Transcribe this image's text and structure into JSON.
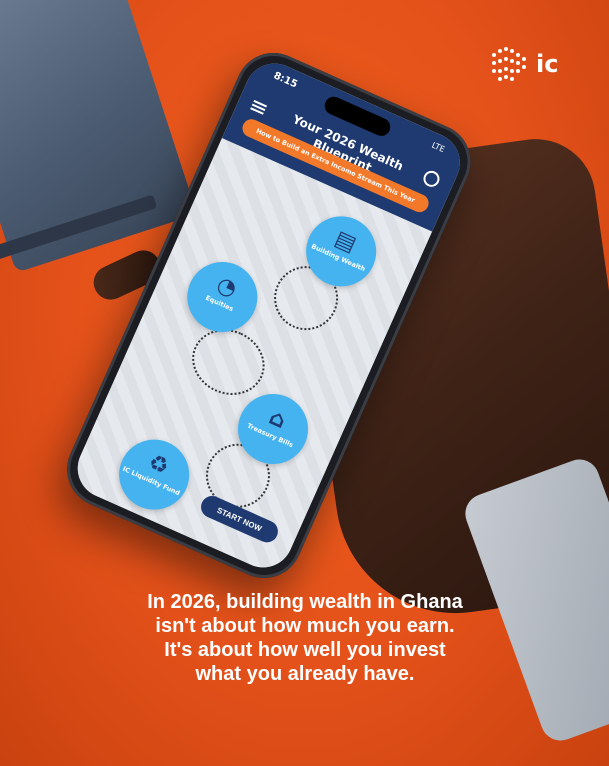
{
  "brand": {
    "logo_text": "ic",
    "accent": "#e8561c"
  },
  "phone": {
    "status_time": "8:15",
    "status_right": "LTE",
    "app_title": "Your 2026 Wealth Blueprint",
    "subtitle": "How to Build an Extra Income Stream This Year",
    "nodes": [
      {
        "label": "Building Wealth",
        "icon": "money-stack-icon"
      },
      {
        "label": "Equities",
        "icon": "pie-chart-people-icon"
      },
      {
        "label": "Treasury Bills",
        "icon": "bank-icon"
      },
      {
        "label": "IC Liquidity Fund",
        "icon": "hands-money-icon"
      }
    ],
    "start_button": "START NOW"
  },
  "caption": {
    "line1": "In 2026, building wealth in Ghana",
    "line2": "isn't about how much you earn.",
    "line3": "It's about how well you invest",
    "line4": "what you already have."
  }
}
